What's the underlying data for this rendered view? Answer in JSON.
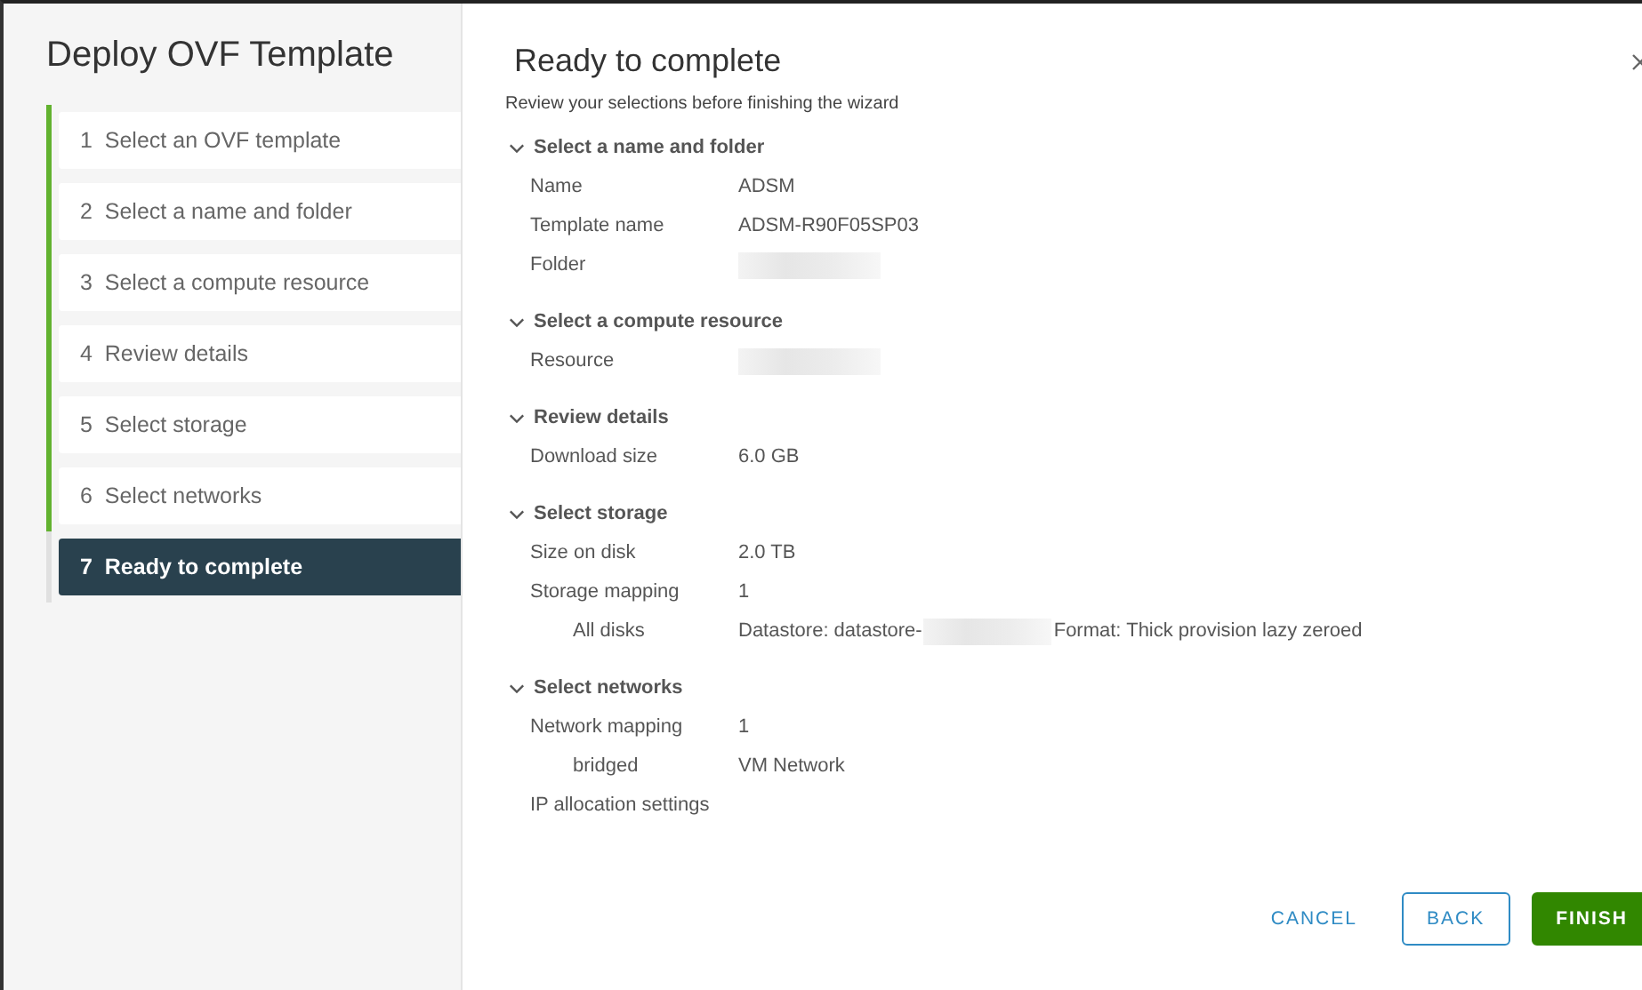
{
  "wizard": {
    "title": "Deploy OVF Template"
  },
  "steps": [
    {
      "number": "1",
      "label": "Select an OVF template",
      "completed": true,
      "selected": false
    },
    {
      "number": "2",
      "label": "Select a name and folder",
      "completed": true,
      "selected": false
    },
    {
      "number": "3",
      "label": "Select a compute resource",
      "completed": true,
      "selected": false
    },
    {
      "number": "4",
      "label": "Review details",
      "completed": true,
      "selected": false
    },
    {
      "number": "5",
      "label": "Select storage",
      "completed": true,
      "selected": false
    },
    {
      "number": "6",
      "label": "Select networks",
      "completed": true,
      "selected": false
    },
    {
      "number": "7",
      "label": "Ready to complete",
      "completed": false,
      "selected": true
    }
  ],
  "page": {
    "title": "Ready to complete",
    "subtitle": "Review your selections before finishing the wizard"
  },
  "sections": [
    {
      "title": "Select a name and folder",
      "expanded": true,
      "rows": [
        {
          "label": "Name",
          "value": "ADSM"
        },
        {
          "label": "Template name",
          "value": "ADSM-R90F05SP03"
        },
        {
          "label": "Folder",
          "redacted": true
        }
      ]
    },
    {
      "title": "Select a compute resource",
      "expanded": true,
      "rows": [
        {
          "label": "Resource",
          "redacted": true
        }
      ]
    },
    {
      "title": "Review details",
      "expanded": true,
      "rows": [
        {
          "label": "Download size",
          "value": "6.0 GB"
        }
      ]
    },
    {
      "title": "Select storage",
      "expanded": true,
      "rows": [
        {
          "label": "Size on disk",
          "value": "2.0 TB"
        },
        {
          "label": "Storage mapping",
          "value": "1",
          "children": [
            {
              "label": "All disks",
              "value": "Datastore: datastore-",
              "redacted": true,
              "value_after": "Format: Thick provision lazy zeroed"
            }
          ]
        }
      ]
    },
    {
      "title": "Select networks",
      "expanded": true,
      "rows": [
        {
          "label": "Network mapping",
          "value": "1",
          "children": [
            {
              "label": "bridged",
              "value": "VM Network"
            }
          ]
        },
        {
          "label": "IP allocation settings"
        }
      ]
    }
  ],
  "buttons": [
    {
      "label": "CANCEL",
      "kind": "flat"
    },
    {
      "label": "BACK",
      "kind": "outline"
    },
    {
      "label": "FINISH",
      "kind": "primary"
    }
  ]
}
